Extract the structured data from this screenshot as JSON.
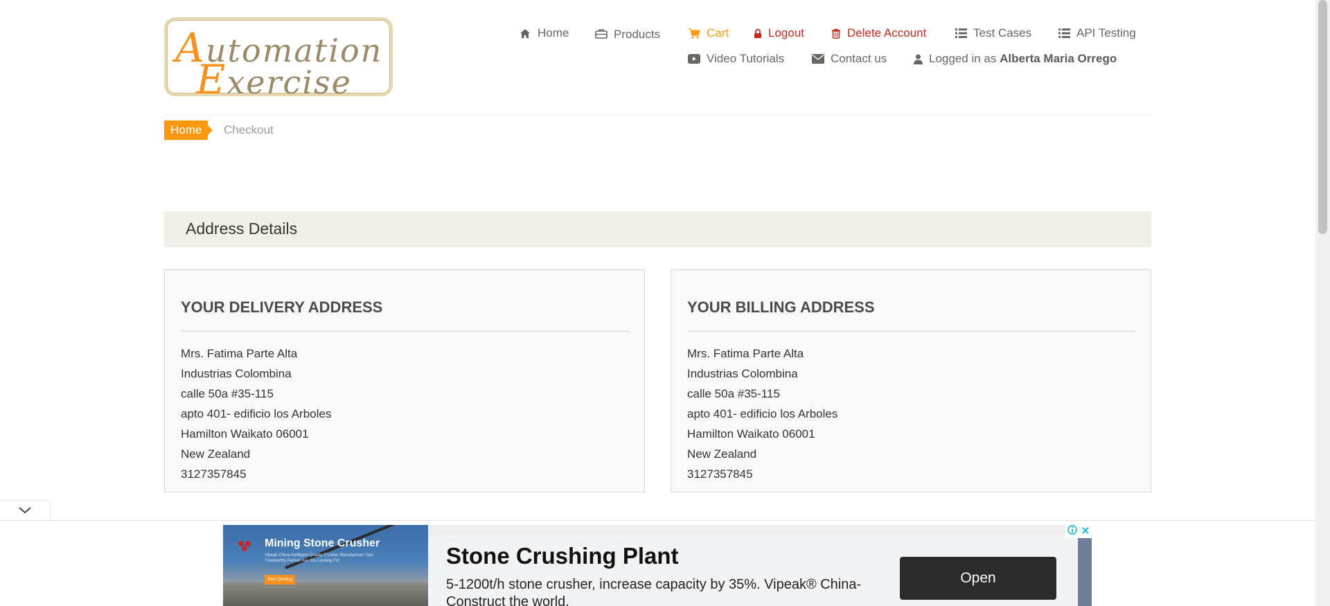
{
  "logo": {
    "line1_cap": "A",
    "line1_rest": "utomation",
    "line2_cap": "E",
    "line2_rest": "xercise"
  },
  "nav": {
    "home": "Home",
    "products": "Products",
    "cart": "Cart",
    "logout": "Logout",
    "delete_account": "Delete Account",
    "test_cases": "Test Cases",
    "api_testing": "API Testing",
    "video_tutorials": "Video Tutorials",
    "contact_us": "Contact us",
    "logged_in_prefix": "Logged in as",
    "logged_in_user": "Alberta Maria Orrego"
  },
  "breadcrumb": {
    "home": "Home",
    "current": "Checkout"
  },
  "address_details": {
    "title": "Address Details"
  },
  "delivery": {
    "heading": "YOUR DELIVERY ADDRESS",
    "lines": [
      "Mrs. Fatima Parte Alta",
      "Industrias Colombina",
      "calle 50a #35-115",
      "apto 401- edificio los Arboles",
      "Hamilton Waikato 06001",
      "New Zealand",
      "3127357845"
    ]
  },
  "billing": {
    "heading": "YOUR BILLING ADDRESS",
    "lines": [
      "Mrs. Fatima Parte Alta",
      "Industrias Colombina",
      "calle 50a #35-115",
      "apto 401- edificio los Arboles",
      "Hamilton Waikato 06001",
      "New Zealand",
      "3127357845"
    ]
  },
  "ad": {
    "image_title": "Mining Stone Crusher",
    "image_sub": "Vipeak-China Intelligent Quality Crusher Manufacturer Your Trustworthy Partner Are You Looking For",
    "image_button": "Start Quoting",
    "title": "Stone Crushing Plant",
    "description": "5-1200t/h stone crusher, increase capacity by 35%. Vipeak® China-Construct the world.",
    "open_label": "Open"
  },
  "colors": {
    "accent": "#FE980F",
    "danger": "#C12A1E",
    "text": "#696763"
  }
}
